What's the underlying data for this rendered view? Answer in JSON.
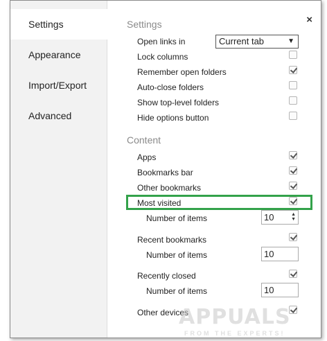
{
  "sidebar": {
    "items": [
      {
        "label": "Settings",
        "active": true
      },
      {
        "label": "Appearance",
        "active": false
      },
      {
        "label": "Import/Export",
        "active": false
      },
      {
        "label": "Advanced",
        "active": false
      }
    ]
  },
  "close_label": "×",
  "settings": {
    "title": "Settings",
    "open_links": {
      "label": "Open links in",
      "value": "Current tab",
      "arrow": "▼"
    },
    "options": [
      {
        "label": "Lock columns",
        "checked": false
      },
      {
        "label": "Remember open folders",
        "checked": true
      },
      {
        "label": "Auto-close folders",
        "checked": false
      },
      {
        "label": "Show top-level folders",
        "checked": false
      },
      {
        "label": "Hide options button",
        "checked": false
      }
    ]
  },
  "content": {
    "title": "Content",
    "apps": {
      "label": "Apps",
      "checked": true
    },
    "bookmarks_bar": {
      "label": "Bookmarks bar",
      "checked": true
    },
    "other_bookmarks": {
      "label": "Other bookmarks",
      "checked": true
    },
    "most_visited": {
      "label": "Most visited",
      "checked": true,
      "items_label": "Number of items",
      "items_value": "10"
    },
    "recent_bookmarks": {
      "label": "Recent bookmarks",
      "checked": true,
      "items_label": "Number of items",
      "items_value": "10"
    },
    "recently_closed": {
      "label": "Recently closed",
      "checked": true,
      "items_label": "Number of items",
      "items_value": "10"
    },
    "other_devices": {
      "label": "Other devices",
      "checked": true
    }
  },
  "colors": {
    "highlight": "#33a24a",
    "sidebar_bg": "#f2f2f2"
  },
  "watermark": {
    "text": "APPUALS",
    "subtext": "FROM THE EXPERTS!"
  }
}
